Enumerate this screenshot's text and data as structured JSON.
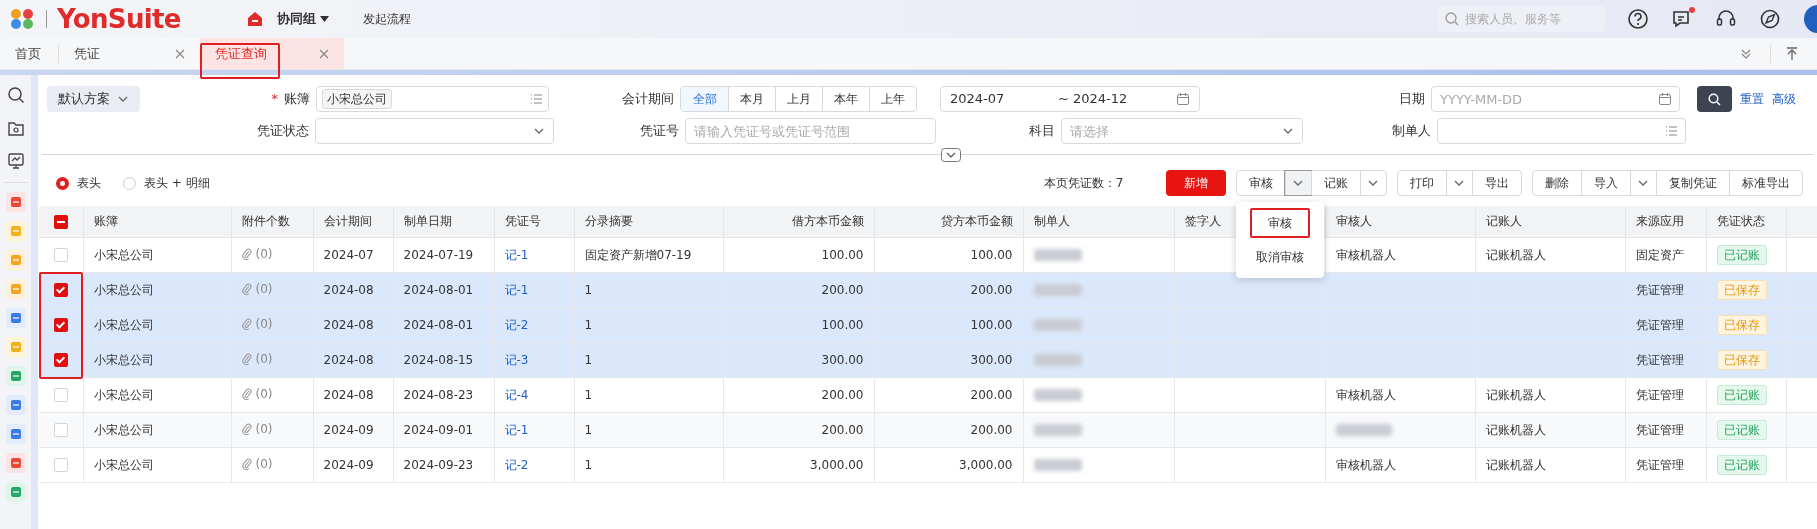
{
  "app": {
    "brand": "YonSuite",
    "nav": [
      {
        "label": "协同组",
        "kind": "dropdown"
      },
      {
        "label": "发起流程",
        "kind": "link"
      }
    ],
    "search_placeholder": "搜索人员、服务等",
    "has_notification": true
  },
  "tabs": [
    {
      "label": "首页",
      "selected": false,
      "closable": false,
      "highlighted": false
    },
    {
      "label": "凭证",
      "selected": false,
      "closable": true,
      "highlighted": false
    },
    {
      "label": "凭证查询",
      "selected": true,
      "closable": true,
      "highlighted": true
    }
  ],
  "filters": {
    "scheme": "默认方案",
    "ledger": {
      "label": "账簿",
      "required_mark": "*",
      "tag": "小宋总公司"
    },
    "period": {
      "label": "会计期间",
      "options": [
        {
          "label": "全部",
          "selected": true
        },
        {
          "label": "本月",
          "selected": false
        },
        {
          "label": "上月",
          "selected": false
        },
        {
          "label": "本年",
          "selected": false
        },
        {
          "label": "上年",
          "selected": false
        }
      ],
      "from": "2024-07",
      "to": "~ 2024-12"
    },
    "date": {
      "label": "日期",
      "placeholder": "YYYY-MM-DD"
    },
    "status": {
      "label": "凭证状态"
    },
    "number": {
      "label": "凭证号",
      "placeholder": "请输入凭证号或凭证号范围"
    },
    "subject": {
      "label": "科目",
      "placeholder": "请选择"
    },
    "maker": {
      "label": "制单人"
    },
    "links": [
      "重置",
      "高级"
    ]
  },
  "view_options": [
    {
      "label": "表头",
      "selected": true
    },
    {
      "label": "表头 + 明细",
      "selected": false
    }
  ],
  "page_count": "本页凭证数：7",
  "toolbar": [
    [
      {
        "kind": "primary",
        "label": "新增"
      }
    ],
    [
      {
        "kind": "button",
        "label": "审核"
      },
      {
        "kind": "caret",
        "open": true
      },
      {
        "kind": "button",
        "label": "记账"
      },
      {
        "kind": "caret",
        "open": false
      }
    ],
    [
      {
        "kind": "button",
        "label": "打印"
      },
      {
        "kind": "caret",
        "open": false
      },
      {
        "kind": "button",
        "label": "导出"
      }
    ],
    [
      {
        "kind": "button",
        "label": "删除"
      },
      {
        "kind": "button",
        "label": "导入"
      },
      {
        "kind": "caret",
        "open": false
      },
      {
        "kind": "button",
        "label": "复制凭证"
      },
      {
        "kind": "button",
        "label": "标准导出"
      }
    ]
  ],
  "dropdown": {
    "items": [
      {
        "label": "审核",
        "highlighted": true
      },
      {
        "label": "取消审核",
        "highlighted": false
      }
    ]
  },
  "table": {
    "header_indeterminate": true,
    "checked_highlight": true,
    "columns": [
      "账簿",
      "附件个数",
      "会计期间",
      "制单日期",
      "凭证号",
      "分录摘要",
      "借方本币金额",
      "贷方本币金额",
      "制单人",
      "签字人",
      "审核人",
      "记账人",
      "来源应用",
      "凭证状态"
    ],
    "rows": [
      {
        "checked": false,
        "ledger": "小宋总公司",
        "attachments": "(0)",
        "period": "2024-07",
        "date": "2024-07-19",
        "number": "记-1",
        "summary": "固定资产新增07-19",
        "debit": "100.00",
        "credit": "100.00",
        "maker_redacted": true,
        "reviewer": "审核机器人",
        "poster": "记账机器人",
        "source": "固定资产",
        "status": {
          "label": "已记账",
          "kind": "posted"
        }
      },
      {
        "checked": true,
        "ledger": "小宋总公司",
        "attachments": "(0)",
        "period": "2024-08",
        "date": "2024-08-01",
        "number": "记-1",
        "summary": "1",
        "debit": "200.00",
        "credit": "200.00",
        "maker_redacted": true,
        "source": "凭证管理",
        "status": {
          "label": "已保存",
          "kind": "saved"
        }
      },
      {
        "checked": true,
        "ledger": "小宋总公司",
        "attachments": "(0)",
        "period": "2024-08",
        "date": "2024-08-01",
        "number": "记-2",
        "summary": "1",
        "debit": "100.00",
        "credit": "100.00",
        "maker_redacted": true,
        "source": "凭证管理",
        "status": {
          "label": "已保存",
          "kind": "saved"
        }
      },
      {
        "checked": true,
        "ledger": "小宋总公司",
        "attachments": "(0)",
        "period": "2024-08",
        "date": "2024-08-15",
        "number": "记-3",
        "summary": "1",
        "debit": "300.00",
        "credit": "300.00",
        "maker_redacted": true,
        "source": "凭证管理",
        "status": {
          "label": "已保存",
          "kind": "saved"
        }
      },
      {
        "checked": false,
        "ledger": "小宋总公司",
        "attachments": "(0)",
        "period": "2024-08",
        "date": "2024-08-23",
        "number": "记-4",
        "summary": "1",
        "debit": "200.00",
        "credit": "200.00",
        "maker_redacted": true,
        "reviewer": "审核机器人",
        "poster": "记账机器人",
        "source": "凭证管理",
        "status": {
          "label": "已记账",
          "kind": "posted"
        }
      },
      {
        "checked": false,
        "ledger": "小宋总公司",
        "attachments": "(0)",
        "period": "2024-09",
        "date": "2024-09-01",
        "number": "记-1",
        "summary": "1",
        "debit": "200.00",
        "credit": "200.00",
        "maker_redacted": true,
        "reviewer_redacted": true,
        "poster": "记账机器人",
        "source": "凭证管理",
        "status": {
          "label": "已记账",
          "kind": "posted"
        }
      },
      {
        "checked": false,
        "ledger": "小宋总公司",
        "attachments": "(0)",
        "period": "2024-09",
        "date": "2024-09-23",
        "number": "记-2",
        "summary": "1",
        "debit": "3,000.00",
        "credit": "3,000.00",
        "maker_redacted": true,
        "reviewer": "审核机器人",
        "poster": "记账机器人",
        "source": "凭证管理",
        "status": {
          "label": "已记账",
          "kind": "posted"
        }
      }
    ]
  }
}
